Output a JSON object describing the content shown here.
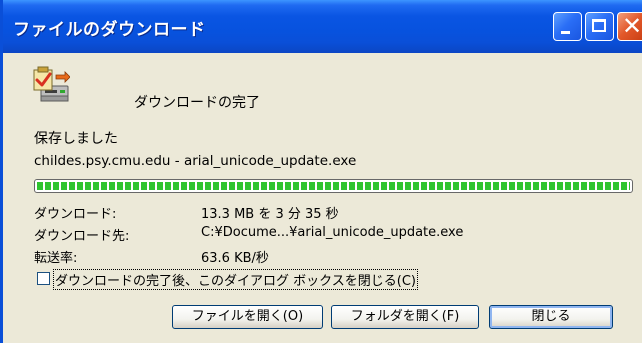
{
  "window": {
    "title": "ファイルのダウンロード",
    "minimize_icon": "minimize-icon",
    "maximize_icon": "maximize-icon",
    "close_glyph": "✕"
  },
  "dialog": {
    "icon": "download-complete-icon",
    "status": "ダウンロードの完了",
    "saved_message": "保存しました",
    "source": "childes.psy.cmu.edu - arial_unicode_update.exe",
    "progress_percent": 100,
    "details": [
      {
        "label": "ダウンロード:",
        "value": "13.3 MB を 3 分 35 秒"
      },
      {
        "label": "ダウンロード先:",
        "value": "C:¥Docume...¥arial_unicode_update.exe"
      },
      {
        "label": "転送率:",
        "value": "63.6 KB/秒"
      }
    ],
    "close_checkbox": {
      "label": "ダウンロードの完了後、このダイアログ ボックスを閉じる(C)",
      "checked": false
    }
  },
  "buttons": {
    "open_file": "ファイルを開く(O)",
    "open_folder": "フォルダを開く(F)",
    "close": "閉じる"
  },
  "colors": {
    "titlebar": "#0a55e3",
    "window_background": "#ece9d8",
    "progress": "#2fc42f",
    "close_button": "#e2582a"
  }
}
